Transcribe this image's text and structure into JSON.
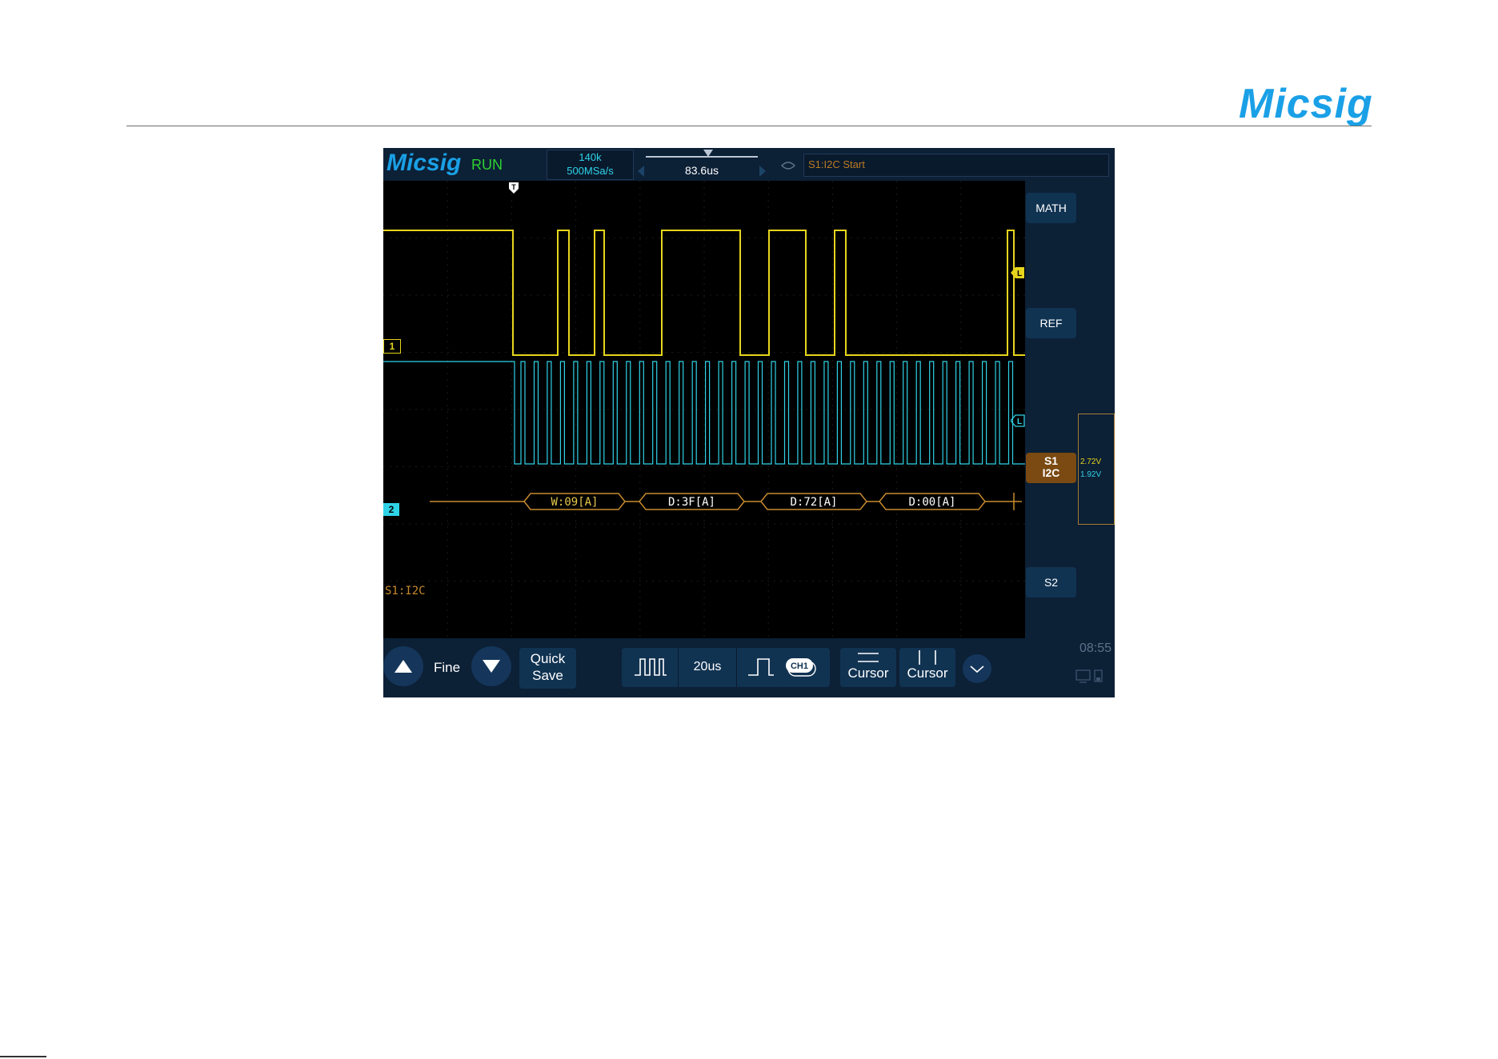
{
  "brand": {
    "logo_text": "Micsig",
    "logo_color": "#1aa0e6"
  },
  "scope": {
    "topbar": {
      "logo": "Micsig",
      "run_state": "RUN",
      "memory_depth": "140k",
      "sample_rate": "500MSa/s",
      "time_offset": "83.6us",
      "trigger_info": "S1:I2C Start"
    },
    "plot": {
      "trigger_marker": "T",
      "ch1_tag": "1",
      "ch2_tag": "2",
      "ch1_color": "#e6d51c",
      "ch2_color": "#2fd3e8",
      "decode_color": "#c78a2c",
      "decode_label": "S1:I2C",
      "decode_packets": [
        "W:09[A]",
        "D:3F[A]",
        "D:72[A]",
        "D:00[A]"
      ],
      "level_marker": "L"
    },
    "side_menu": {
      "math": "MATH",
      "ref": "REF",
      "s1_line1": "S1",
      "s1_line2": "I2C",
      "s2": "S2",
      "ch1_threshold": "2.72V",
      "ch2_threshold": "1.92V"
    },
    "bottom_bar": {
      "fine_label": "Fine",
      "quick_save_line1": "Quick",
      "quick_save_line2": "Save",
      "timebase": "20us",
      "channel_badge": "CH1",
      "cursor_h_label": "Cursor",
      "cursor_v_label": "Cursor",
      "clock": "08:55"
    }
  }
}
